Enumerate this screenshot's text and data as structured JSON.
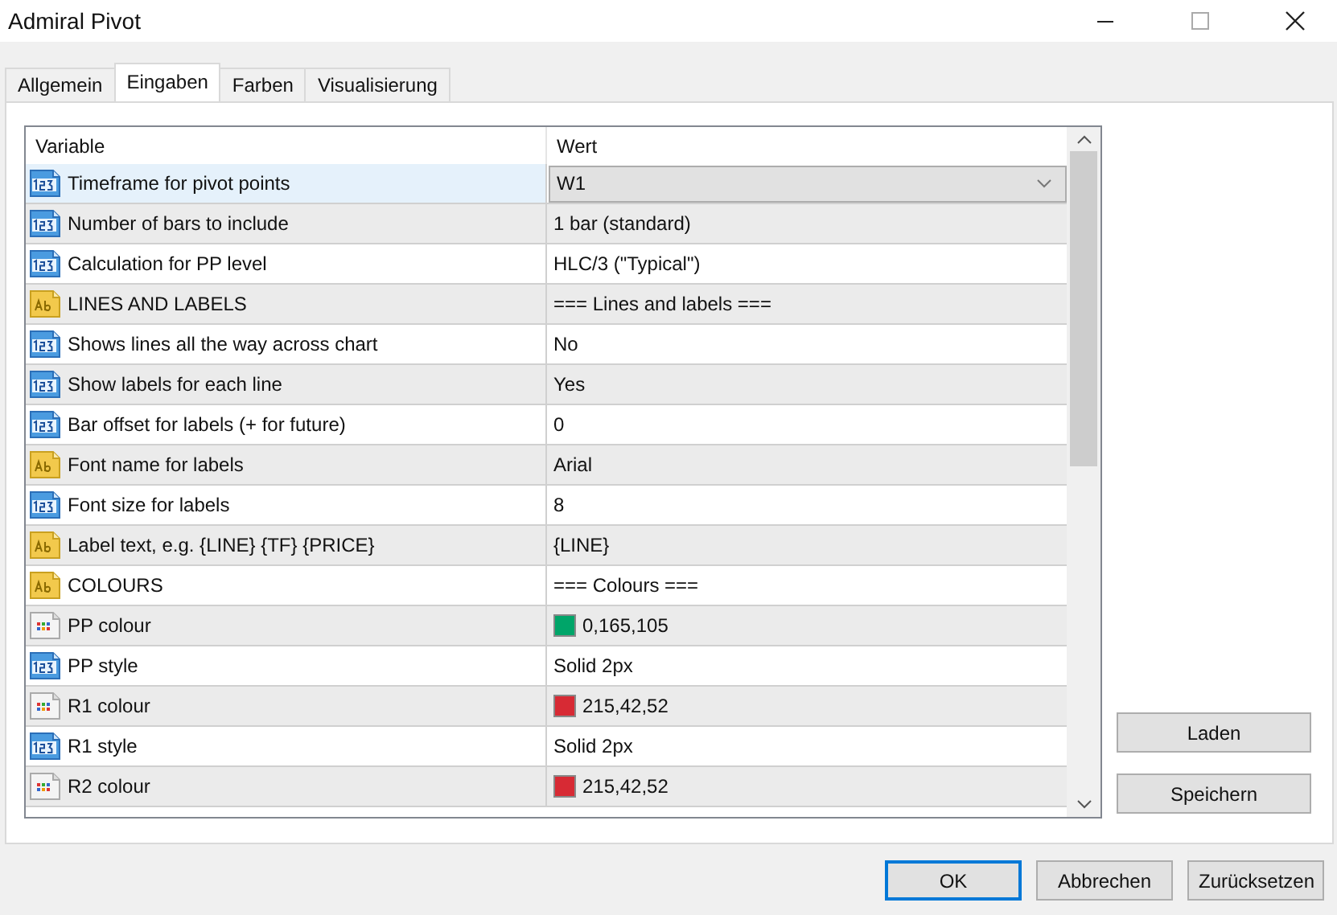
{
  "window": {
    "title": "Admiral Pivot"
  },
  "tabs": [
    {
      "label": "Allgemein",
      "selected": false
    },
    {
      "label": "Eingaben",
      "selected": true
    },
    {
      "label": "Farben",
      "selected": false
    },
    {
      "label": "Visualisierung",
      "selected": false
    }
  ],
  "table": {
    "columns": [
      "Variable",
      "Wert"
    ],
    "rows": [
      {
        "kind": "number",
        "variable": "Timeframe for pivot points",
        "value": "W1",
        "selected": true
      },
      {
        "kind": "number",
        "variable": "Number of bars to include",
        "value": "1 bar (standard)",
        "selected": false
      },
      {
        "kind": "number",
        "variable": "Calculation for PP level",
        "value": "HLC/3 (\"Typical\")",
        "selected": false
      },
      {
        "kind": "text",
        "variable": "LINES AND LABELS",
        "value": "=== Lines and labels ===",
        "selected": false
      },
      {
        "kind": "number",
        "variable": "Shows lines all the way across chart",
        "value": "No",
        "selected": false
      },
      {
        "kind": "number",
        "variable": "Show labels for each line",
        "value": "Yes",
        "selected": false
      },
      {
        "kind": "number",
        "variable": "Bar offset for labels (+ for future)",
        "value": "0",
        "selected": false
      },
      {
        "kind": "text",
        "variable": "Font name for labels",
        "value": "Arial",
        "selected": false
      },
      {
        "kind": "number",
        "variable": "Font size for labels",
        "value": "8",
        "selected": false
      },
      {
        "kind": "text",
        "variable": "Label text, e.g. {LINE} {TF} {PRICE}",
        "value": "{LINE}",
        "selected": false
      },
      {
        "kind": "text",
        "variable": "COLOURS",
        "value": "=== Colours ===",
        "selected": false
      },
      {
        "kind": "color",
        "variable": "PP colour",
        "value": "0,165,105",
        "color": "#00a569",
        "selected": false
      },
      {
        "kind": "number",
        "variable": "PP style",
        "value": "Solid 2px",
        "selected": false
      },
      {
        "kind": "color",
        "variable": "R1 colour",
        "value": "215,42,52",
        "color": "#d72a34",
        "selected": false
      },
      {
        "kind": "number",
        "variable": "R1 style",
        "value": "Solid 2px",
        "selected": false
      },
      {
        "kind": "color",
        "variable": "R2 colour",
        "value": "215,42,52",
        "color": "#d72a34",
        "selected": false
      }
    ]
  },
  "side_buttons": [
    "Laden",
    "Speichern"
  ],
  "buttons": [
    {
      "label": "OK",
      "default": true
    },
    {
      "label": "Abbrechen",
      "default": false
    },
    {
      "label": "Zurücksetzen",
      "default": false
    }
  ]
}
